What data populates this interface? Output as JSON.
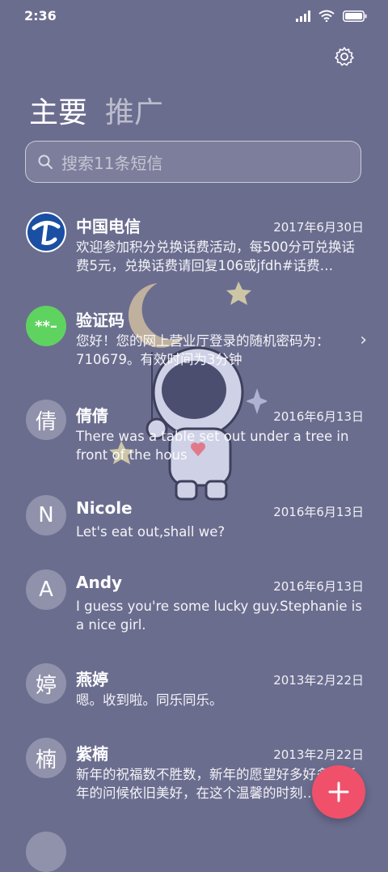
{
  "status": {
    "time": "2:36"
  },
  "tabs": {
    "primary": "主要",
    "promo": "推广"
  },
  "search": {
    "placeholder": "搜索11条短信"
  },
  "messages": [
    {
      "name": "中国电信",
      "date": "2017年6月30日",
      "preview": "欢迎参加积分兑换话费活动，每500分可兑换话费5元，兑换话费请回复106或jfdh#话费…",
      "avatar": "telecom-logo"
    },
    {
      "name": "验证码",
      "date": "",
      "preview": "您好！您的网上营业厅登录的随机密码为：710679。有效时间为3分钟",
      "avatar_text": "**–"
    },
    {
      "name": "倩倩",
      "date": "2016年6月13日",
      "preview": "There was a table set out under a tree in front of the hous",
      "avatar_text": "倩"
    },
    {
      "name": "Nicole",
      "date": "2016年6月13日",
      "preview": "Let's eat out,shall we?",
      "avatar_text": "N"
    },
    {
      "name": "Andy",
      "date": "2016年6月13日",
      "preview": "I guess you're some lucky guy.Stephanie is a nice girl.",
      "avatar_text": "A"
    },
    {
      "name": "燕婷",
      "date": "2013年2月22日",
      "preview": "嗯。收到啦。同乐同乐。",
      "avatar_text": "婷"
    },
    {
      "name": "紫楠",
      "date": "2013年2月22日",
      "preview": "新年的祝福数不胜数，新年的愿望好多好多，新年的问候依旧美好，在这个温馨的时刻…",
      "avatar_text": "楠"
    }
  ],
  "colors": {
    "background": "#6b6d8f",
    "fab": "#f0506a",
    "otp_avatar": "#5fd35f",
    "telecom_blue": "#1a4fa3"
  }
}
